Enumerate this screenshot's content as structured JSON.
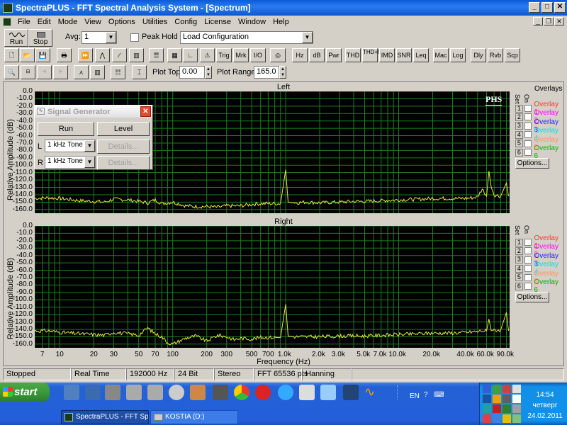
{
  "window": {
    "title": "SpectraPLUS - FFT Spectral Analysis System - [Spectrum]"
  },
  "menu": [
    "File",
    "Edit",
    "Mode",
    "View",
    "Options",
    "Utilities",
    "Config",
    "License",
    "Window",
    "Help"
  ],
  "toolbar": {
    "run_label": "Run",
    "stop_label": "Stop",
    "avg_label": "Avg:",
    "avg_value": "1",
    "peak_hold_label": "Peak Hold",
    "load_config_value": "Load Configuration",
    "buttons_text": [
      "Trig",
      "Mrk",
      "I/O",
      "Hz",
      "dB",
      "Pwr",
      "THD",
      "THD+N",
      "IMD",
      "SNR",
      "Leq",
      "Mac",
      "Log",
      "Dly",
      "Rvb",
      "Scp"
    ],
    "plot_top_label": "Plot Top:",
    "plot_top_value": "0.00",
    "plot_range_label": "Plot Range:",
    "plot_range_value": "165.0"
  },
  "plots": {
    "left_title": "Left",
    "right_title": "Right",
    "ylabel": "Relative Amplitude (dB)",
    "xlabel": "Frequency (Hz)",
    "yticks": [
      "0.0",
      "-10.0",
      "-20.0",
      "-30.0",
      "-40.0",
      "-50.0",
      "-60.0",
      "-70.0",
      "-80.0",
      "-90.0",
      "-100.0",
      "-110.0",
      "-120.0",
      "-130.0",
      "-140.0",
      "-150.0",
      "-160.0"
    ],
    "xticks": [
      "7",
      "10",
      "20",
      "30",
      "50",
      "70",
      "100",
      "200",
      "300",
      "500",
      "700",
      "1.0k",
      "2.0k",
      "3.0k",
      "5.0k",
      "7.0k",
      "10.0k",
      "20.0k",
      "40.0k",
      "60.0k",
      "90.0k"
    ],
    "logo": "PHS"
  },
  "overlays": {
    "title": "Overlays",
    "set_label": "Set",
    "on_label": "On",
    "items": [
      {
        "num": "1",
        "name": "Overlay 1",
        "color": "#ff3030"
      },
      {
        "num": "2",
        "name": "Overlay 2",
        "color": "#ff00ff"
      },
      {
        "num": "3",
        "name": "Overlay 3",
        "color": "#2020ff"
      },
      {
        "num": "4",
        "name": "Overlay 4",
        "color": "#00e0e0"
      },
      {
        "num": "5",
        "name": "Overlay 5",
        "color": "#ff9060"
      },
      {
        "num": "6",
        "name": "Overlay 6",
        "color": "#00b000"
      }
    ],
    "options_label": "Options..."
  },
  "siggen": {
    "title": "Signal Generator",
    "run_label": "Run",
    "level_label": "Level",
    "l_label": "L",
    "r_label": "R",
    "l_value": "1 kHz Tone",
    "r_value": "1 kHz Tone",
    "details_label": "Details..."
  },
  "status": [
    "Stopped",
    "Real Time",
    "192000 Hz",
    "24 Bit",
    "Stereo",
    "FFT 65536 pts",
    "Hanning"
  ],
  "taskbar": {
    "start_label": "start",
    "tasks": [
      "SpectraPLUS - FFT Sp...",
      "KOSTIA (D:)"
    ],
    "lang": "EN",
    "time": "14:54",
    "day": "четверг",
    "date": "24.02.2011"
  },
  "chart_data": [
    {
      "type": "line",
      "title": "Left",
      "xlabel": "Frequency (Hz)",
      "ylabel": "Relative Amplitude (dB)",
      "xscale": "log",
      "xlim": [
        6,
        96000
      ],
      "ylim": [
        -165,
        0
      ],
      "grid": true,
      "series": [
        {
          "color": "#e8e840",
          "x": [
            6,
            8,
            10,
            15,
            20,
            25,
            30,
            40,
            50,
            60,
            70,
            80,
            100,
            130,
            160,
            200,
            250,
            300,
            350,
            400,
            500,
            600,
            700,
            800,
            900,
            1000,
            1050,
            1200,
            1500,
            2000,
            3000,
            4000,
            5000,
            7000,
            10000,
            15000,
            20000,
            30000,
            40000,
            50000,
            55000,
            60000,
            63000,
            66000,
            70000,
            80000,
            90000,
            94000
          ],
          "y": [
            -145,
            -144,
            -145,
            -148,
            -149,
            -150,
            -146,
            -147,
            -149,
            -151,
            -147,
            -152,
            -150,
            -155,
            -156,
            -156,
            -157,
            -155,
            -155,
            -155,
            -153,
            -152,
            -152,
            -152,
            -152,
            -106,
            -150,
            -151,
            -150,
            -151,
            -150,
            -149,
            -149,
            -148,
            -147,
            -146,
            -145,
            -145,
            -145,
            -143,
            -132,
            -142,
            -108,
            -130,
            -140,
            -142,
            -124,
            -142
          ]
        }
      ]
    },
    {
      "type": "line",
      "title": "Right",
      "xlabel": "Frequency (Hz)",
      "ylabel": "Relative Amplitude (dB)",
      "xscale": "log",
      "xlim": [
        6,
        96000
      ],
      "ylim": [
        -165,
        0
      ],
      "grid": true,
      "series": [
        {
          "color": "#e8e840",
          "x": [
            6,
            8,
            10,
            15,
            20,
            25,
            30,
            40,
            50,
            60,
            70,
            80,
            90,
            100,
            130,
            160,
            200,
            250,
            300,
            350,
            400,
            500,
            600,
            700,
            800,
            900,
            1000,
            1050,
            1200,
            1500,
            2000,
            3000,
            4000,
            5000,
            7000,
            10000,
            15000,
            20000,
            30000,
            40000,
            50000,
            55000,
            60000,
            63000,
            66000,
            70000,
            80000,
            90000,
            94000
          ],
          "y": [
            -142,
            -142,
            -144,
            -146,
            -147,
            -148,
            -144,
            -146,
            -148,
            -138,
            -146,
            -150,
            -158,
            -160,
            -152,
            -149,
            -156,
            -148,
            -150,
            -154,
            -152,
            -153,
            -151,
            -151,
            -151,
            -151,
            -106,
            -149,
            -150,
            -150,
            -150,
            -149,
            -149,
            -149,
            -148,
            -147,
            -146,
            -145,
            -145,
            -144,
            -143,
            -142,
            -142,
            -126,
            -142,
            -141,
            -141,
            -117,
            -142
          ]
        }
      ]
    }
  ]
}
